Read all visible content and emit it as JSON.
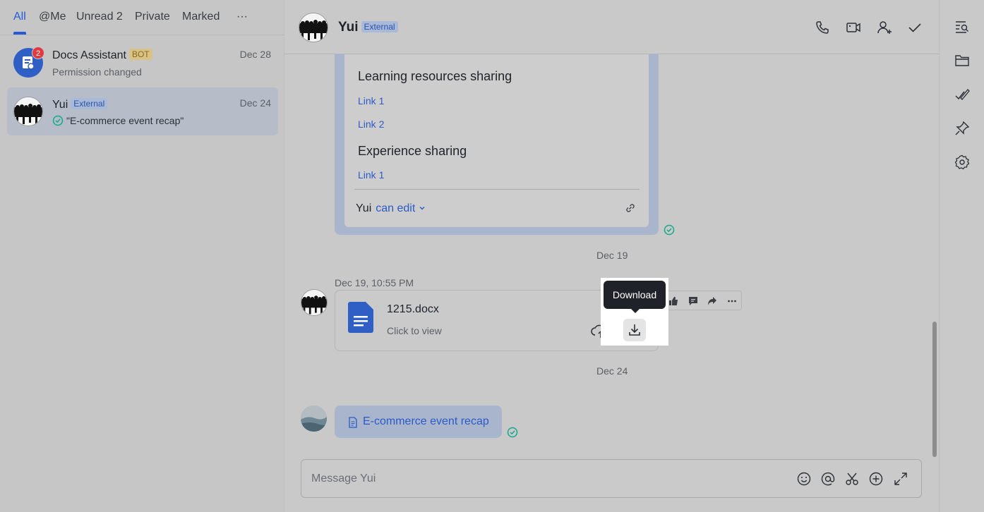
{
  "tabs": [
    {
      "label": "All",
      "active": true
    },
    {
      "label": "@Me"
    },
    {
      "label": "Unread 2"
    },
    {
      "label": "Private"
    },
    {
      "label": "Marked"
    },
    {
      "label": "···"
    }
  ],
  "chats": [
    {
      "name": "Docs Assistant",
      "tag": "BOT",
      "preview": "Permission changed",
      "date": "Dec 28",
      "unread": "2",
      "avatar_icon": "docs-bot-icon"
    },
    {
      "name": "Yui",
      "tag": "External",
      "preview": "\"E-commerce event recap\"",
      "date": "Dec 24",
      "selected": true,
      "avatar_icon": "crowd-photo"
    }
  ],
  "header": {
    "name": "Yui",
    "tag": "External",
    "icons": [
      "phone-icon",
      "video-icon",
      "add-member-icon",
      "done-icon"
    ]
  },
  "doc_card": {
    "heading1": "Learning resources sharing",
    "links1": [
      "Link 1",
      "Link 2"
    ],
    "heading2": "Experience sharing",
    "links2": [
      "Link 1"
    ],
    "perm_user": "Yui",
    "perm_level": "can edit"
  },
  "date_separators": [
    "Dec 19",
    "Dec 24"
  ],
  "file_message": {
    "time": "Dec 19, 10:55 PM",
    "file_name": "1215.docx",
    "sub": "Click to view",
    "tooltip": "Download"
  },
  "doc_message": {
    "title": "E-commerce event recap"
  },
  "composer": {
    "placeholder": "Message Yui",
    "icons": [
      "emoji-icon",
      "mention-icon",
      "scissors-icon",
      "add-icon",
      "expand-icon"
    ]
  },
  "rail_icons": [
    "search-history-icon",
    "folder-icon",
    "tasks-icon",
    "pin-icon",
    "settings-icon"
  ],
  "colors": {
    "accent": "#245bdb",
    "link": "#2a5bc7",
    "success": "#14a98a",
    "badge": "#e0393e"
  }
}
